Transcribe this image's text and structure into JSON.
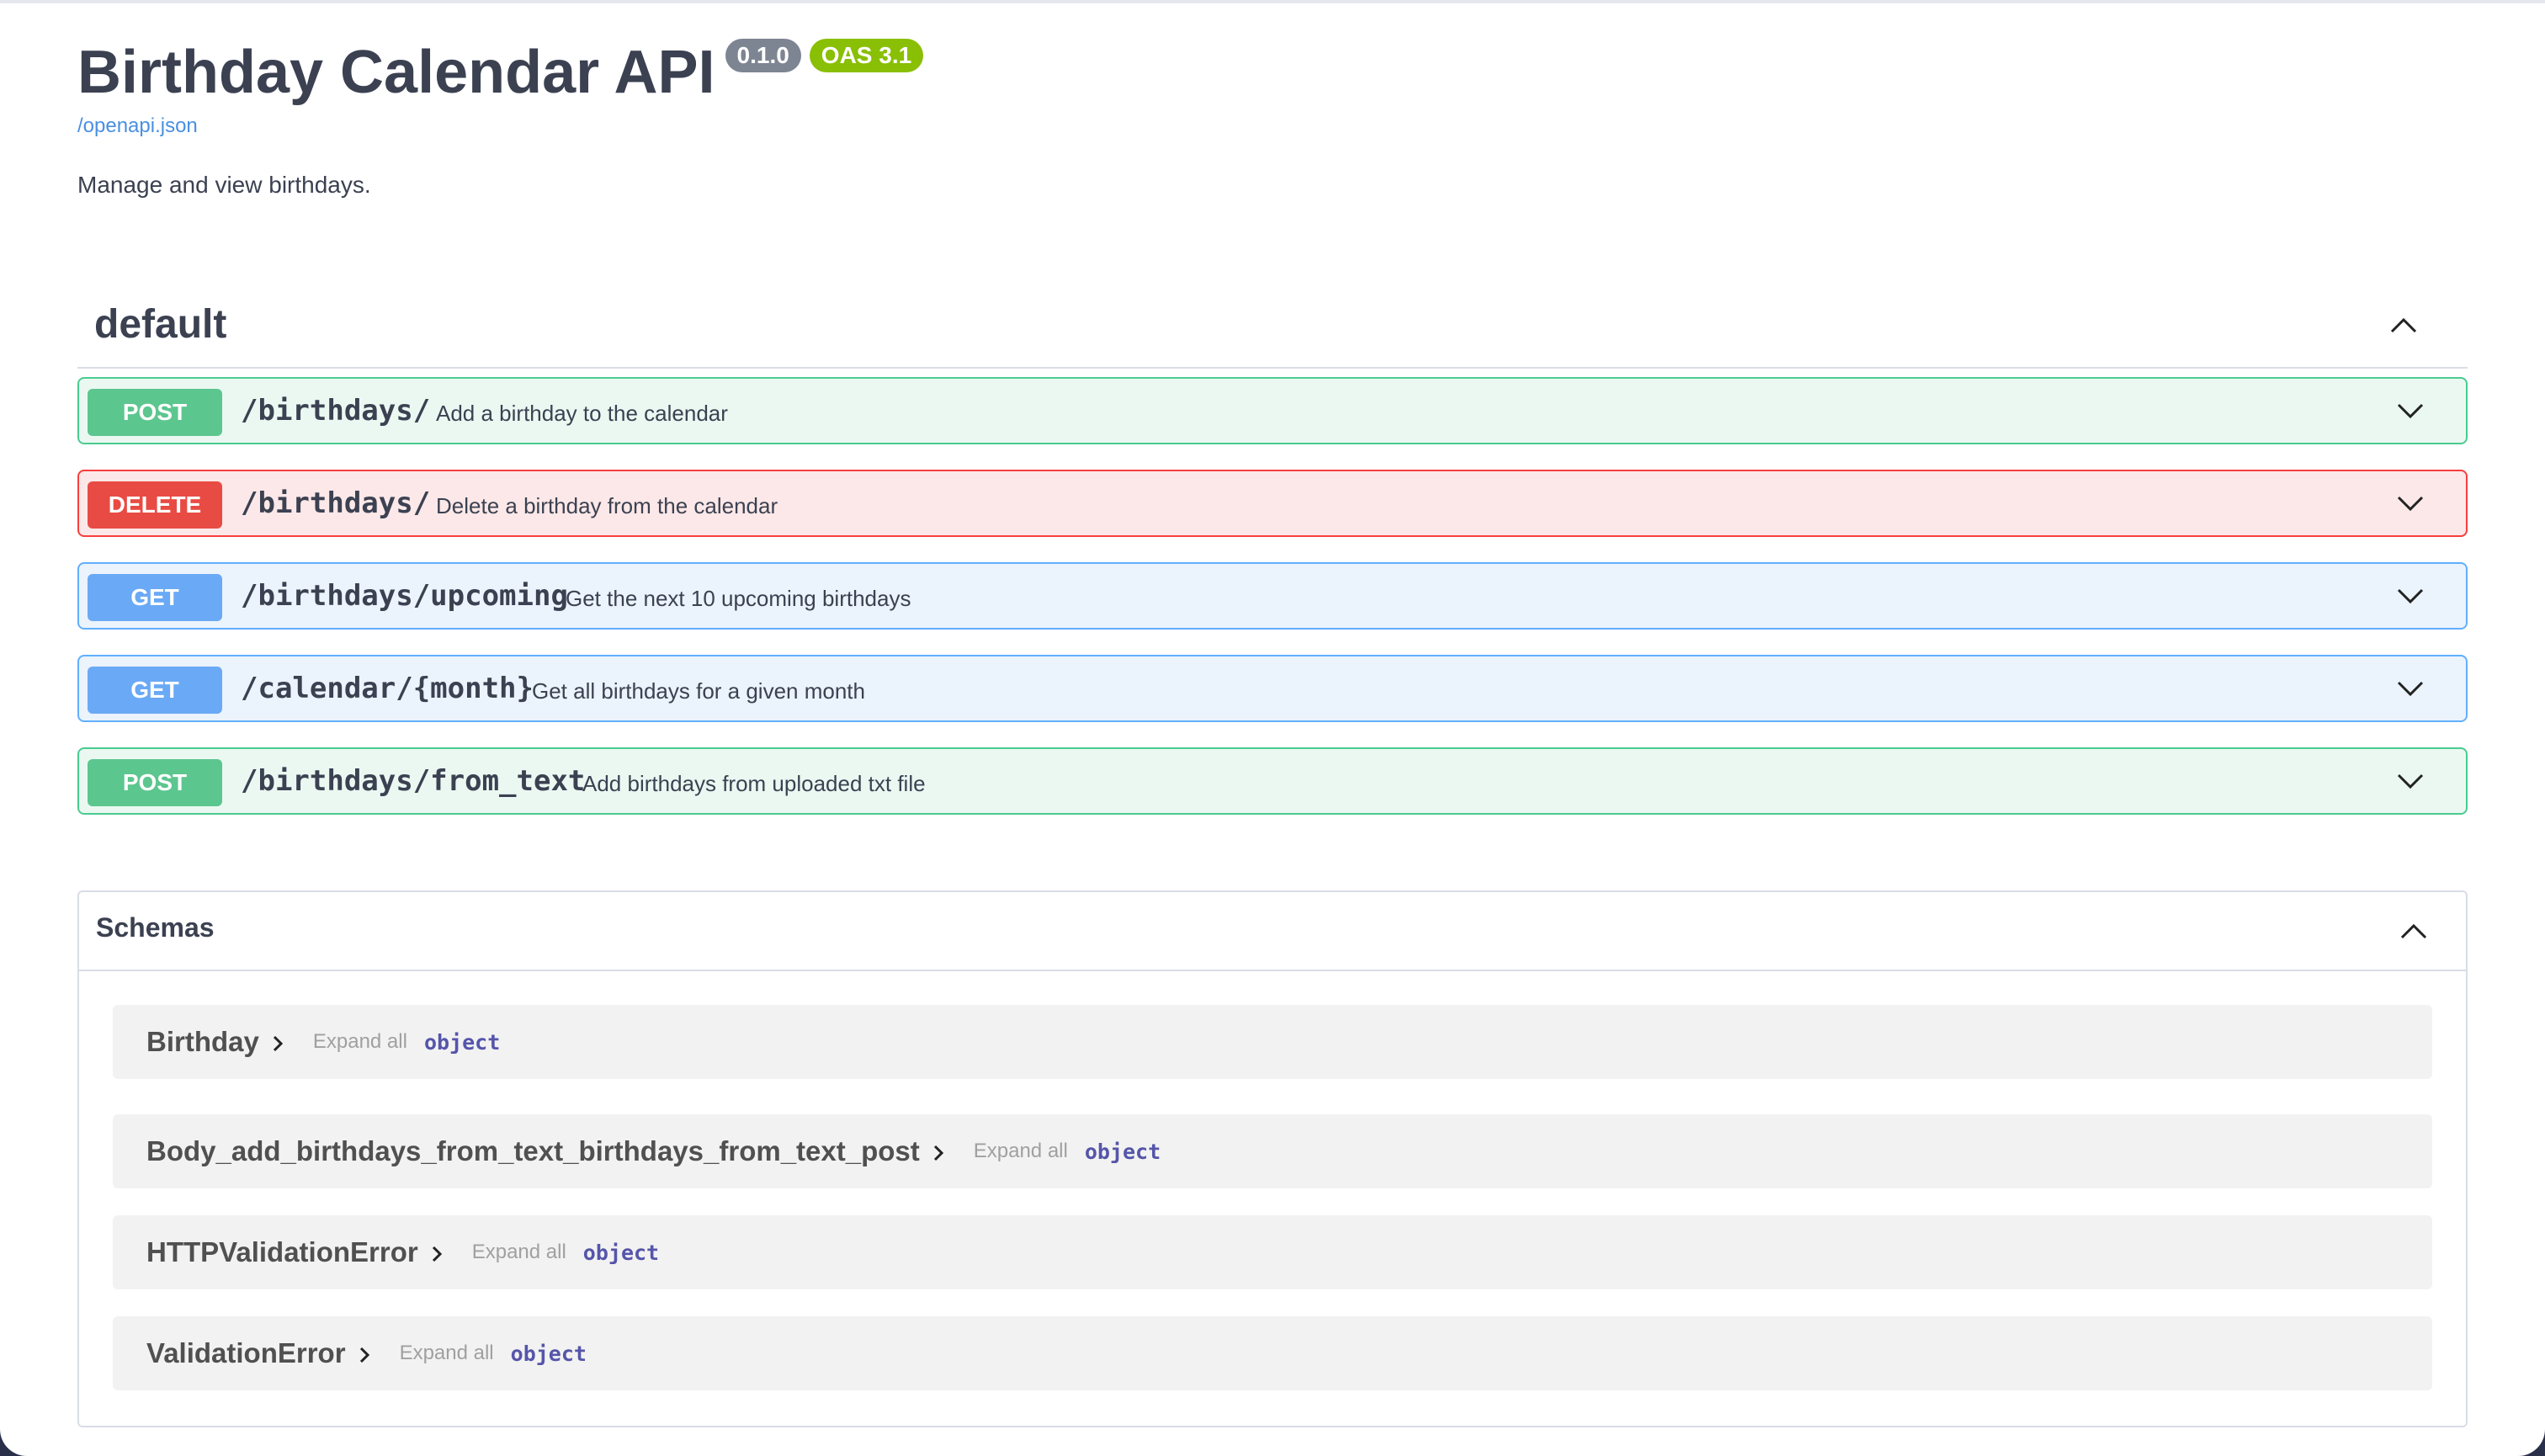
{
  "info": {
    "title": "Birthday Calendar API",
    "version": "0.1.0",
    "oas_version": "OAS 3.1",
    "spec_link": "/openapi.json",
    "description": "Manage and view birthdays."
  },
  "tag": {
    "name": "default",
    "expanded": true
  },
  "operations": [
    {
      "method": "POST",
      "path": "/birthdays/",
      "summary": "Add a birthday to the calendar",
      "color": "#49cc90"
    },
    {
      "method": "DELETE",
      "path": "/birthdays/",
      "summary": "Delete a birthday from the calendar",
      "color": "#f93e3e"
    },
    {
      "method": "GET",
      "path": "/birthdays/upcoming",
      "summary": "Get the next 10 upcoming birthdays",
      "color": "#61affe"
    },
    {
      "method": "GET",
      "path": "/calendar/{month}",
      "summary": "Get all birthdays for a given month",
      "color": "#61affe"
    },
    {
      "method": "POST",
      "path": "/birthdays/from_text",
      "summary": "Add birthdays from uploaded txt file",
      "color": "#49cc90"
    }
  ],
  "schemas": {
    "title": "Schemas",
    "expand_label": "Expand all",
    "models": [
      {
        "name": "Birthday",
        "type": "object"
      },
      {
        "name": "Body_add_birthdays_from_text_birthdays_from_text_post",
        "type": "object"
      },
      {
        "name": "HTTPValidationError",
        "type": "object"
      },
      {
        "name": "ValidationError",
        "type": "object"
      }
    ]
  }
}
